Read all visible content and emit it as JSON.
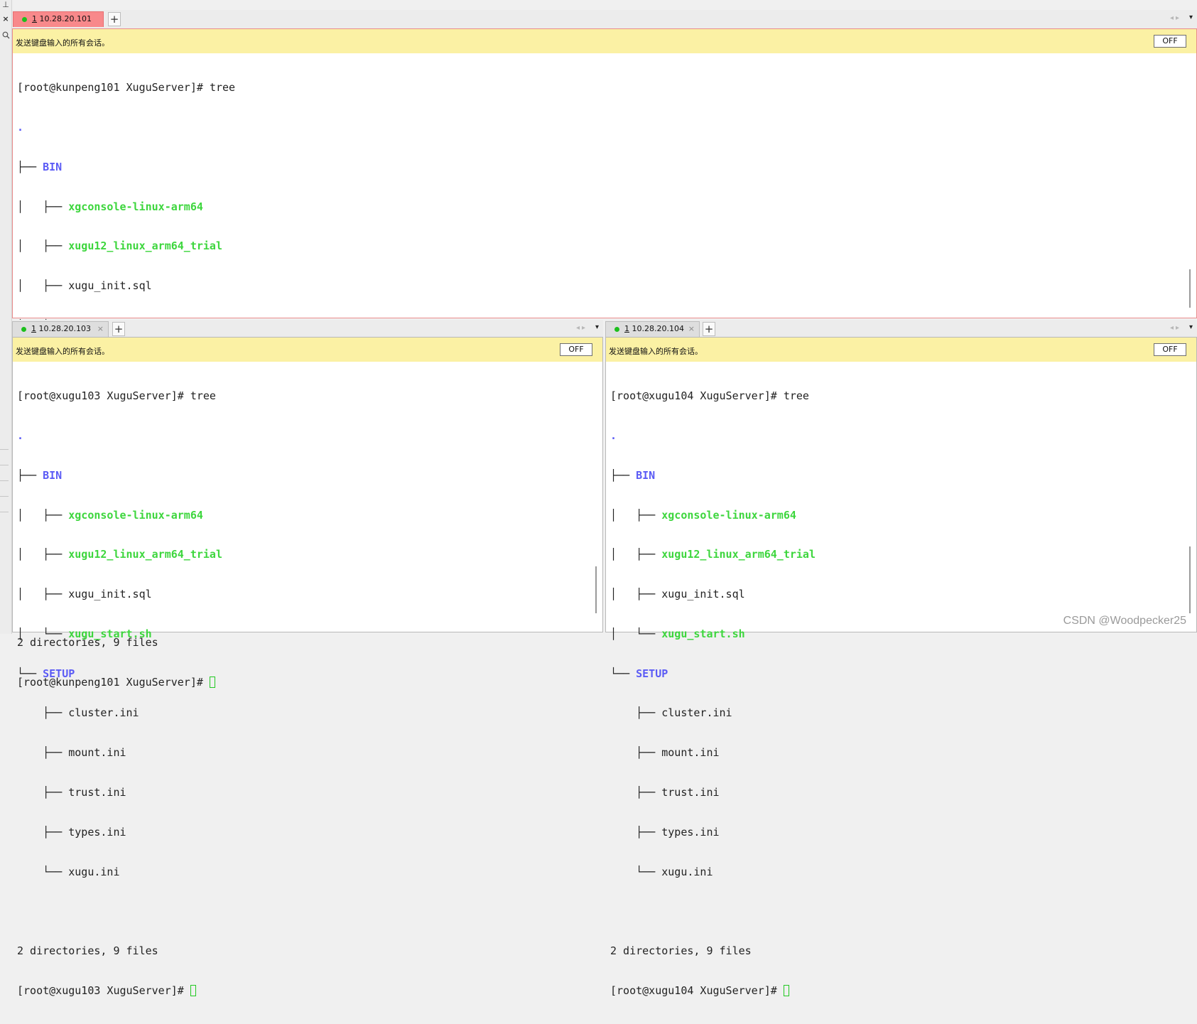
{
  "notice_text": "发送键盘输入的所有会话。",
  "off_label": "OFF",
  "add_tab_label": "+",
  "close_tab_glyph": "×",
  "left_strip": {
    "close_glyph": "×",
    "search_icon": "search-icon"
  },
  "panes": {
    "top": {
      "tab_number": "1",
      "tab_label": " 10.28.20.101",
      "host": "kunpeng101",
      "prompt": "[root@kunpeng101 XuguServer]# ",
      "command": "tree"
    },
    "left": {
      "tab_number": "1",
      "tab_label": " 10.28.20.103",
      "host": "xugu103",
      "prompt": "[root@xugu103 XuguServer]# ",
      "command": "tree"
    },
    "right": {
      "tab_number": "1",
      "tab_label": " 10.28.20.104",
      "host": "xugu104",
      "prompt": "[root@xugu104 XuguServer]# ",
      "command": "tree"
    }
  },
  "tree": {
    "root": ".",
    "bin_branch": "├── ",
    "bin": "BIN",
    "bin_files": [
      {
        "prefix": "│   ├── ",
        "name": "xgconsole-linux-arm64",
        "kind": "exe"
      },
      {
        "prefix": "│   ├── ",
        "name": "xugu12_linux_arm64_trial",
        "kind": "exe"
      },
      {
        "prefix": "│   ├── ",
        "name": "xugu_init.sql",
        "kind": "file"
      },
      {
        "prefix": "│   └── ",
        "name": "xugu_start.sh",
        "kind": "exe"
      }
    ],
    "setup_branch": "└── ",
    "setup": "SETUP",
    "setup_files": [
      {
        "prefix": "    ├── ",
        "name": "cluster.ini"
      },
      {
        "prefix": "    ├── ",
        "name": "mount.ini"
      },
      {
        "prefix": "    ├── ",
        "name": "trust.ini"
      },
      {
        "prefix": "    ├── ",
        "name": "types.ini"
      },
      {
        "prefix": "    └── ",
        "name": "xugu.ini"
      }
    ],
    "summary": "2 directories, 9 files"
  },
  "watermark": "CSDN @Woodpecker25",
  "colors": {
    "active_tab": "#f8898b",
    "notice_bar": "#fbf1a4",
    "directory": "#5b5bf5",
    "executable": "#3dd63d",
    "cursor": "#22c922"
  }
}
